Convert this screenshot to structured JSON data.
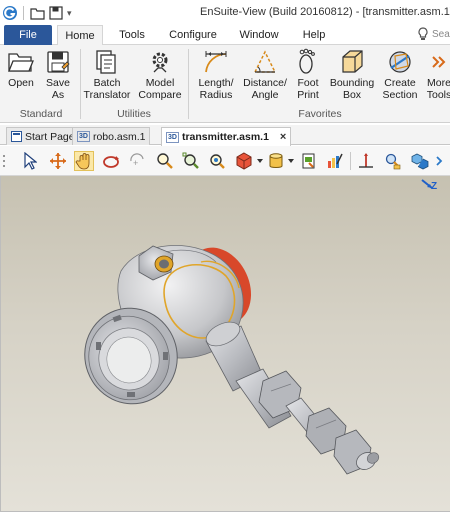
{
  "window": {
    "title": "EnSuite-View (Build 20160812) - [transmitter.asm.1]"
  },
  "menubar": {
    "file": "File",
    "tabs": [
      "Home",
      "Tools",
      "Configure",
      "Window",
      "Help"
    ],
    "active_tab": "Home",
    "search_placeholder": "Sea"
  },
  "ribbon": {
    "buttons": [
      {
        "label": "Open",
        "icon": "folder-open-icon"
      },
      {
        "label": "Save\nAs",
        "icon": "save-as-icon"
      },
      {
        "label": "Batch\nTranslator",
        "icon": "batch-translator-icon"
      },
      {
        "label": "Model\nCompare",
        "icon": "model-compare-icon"
      },
      {
        "label": "Length/\nRadius",
        "icon": "length-radius-icon"
      },
      {
        "label": "Distance/\nAngle",
        "icon": "distance-angle-icon"
      },
      {
        "label": "Foot\nPrint",
        "icon": "footprint-icon"
      },
      {
        "label": "Bounding\nBox",
        "icon": "bounding-box-icon"
      },
      {
        "label": "Create\nSection",
        "icon": "create-section-icon"
      },
      {
        "label": "More\nTools",
        "icon": "more-tools-icon"
      }
    ],
    "groups": [
      "Standard",
      "Utilities",
      "Favorites"
    ]
  },
  "doc_tabs": [
    {
      "label": "Start Page",
      "badge": ""
    },
    {
      "label": "robo.asm.1",
      "badge": "3D"
    },
    {
      "label": "transmitter.asm.1",
      "badge": "3D",
      "active": true
    }
  ],
  "doc_tab_close": "×",
  "toolbar": {
    "tools": [
      "select-arrow-icon",
      "pan-icon",
      "rotate-icon",
      "spin-icon",
      "rotate-step-icon",
      "zoom-icon",
      "zoom-fit-icon",
      "zoom-window-icon",
      "shaded-cube-icon",
      "cylinder-icon",
      "export-icon",
      "paint-icon",
      "axis-icon",
      "search-model-icon",
      "explode-icon"
    ]
  },
  "viewport": {
    "axis_label": "Z",
    "model": "transmitter assembly"
  },
  "colors": {
    "file_tab": "#2b579a",
    "ribbon_bg": "#f3f3f3",
    "viewport_top": "#c6c1b1",
    "viewport_bottom": "#e4e1d8",
    "model_gray": "#cfd0d2",
    "cap_red": "#d8482a",
    "highlight_orange": "#e0a52a"
  }
}
